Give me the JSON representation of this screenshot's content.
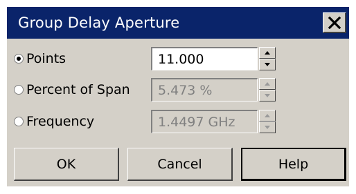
{
  "dialog": {
    "title": "Group Delay Aperture",
    "close_label": "close"
  },
  "options": [
    {
      "label": "Points",
      "value": "11.000",
      "selected": true,
      "enabled": true
    },
    {
      "label": "Percent of Span",
      "value": "5.473 %",
      "selected": false,
      "enabled": false
    },
    {
      "label": "Frequency",
      "value": "1.4497 GHz",
      "selected": false,
      "enabled": false
    }
  ],
  "buttons": {
    "ok": "OK",
    "cancel": "Cancel",
    "help": "Help"
  },
  "colors": {
    "titlebar": "#0a246a",
    "face": "#d4d0c8",
    "disabled_text": "#808080"
  }
}
